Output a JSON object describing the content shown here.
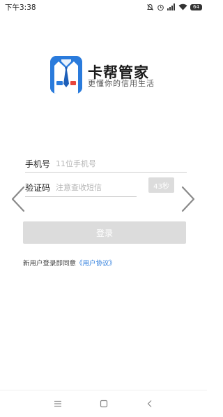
{
  "status_bar": {
    "time": "下午3:38",
    "battery": "64",
    "icons": [
      "mute-icon",
      "alarm-icon",
      "signal-icon",
      "wifi-icon",
      "battery-icon"
    ]
  },
  "app": {
    "name": "卡帮管家",
    "slogan": "更懂你的信用生活",
    "icon_color": "#2a7bdc"
  },
  "form": {
    "phone_label": "手机号",
    "phone_placeholder": "11位手机号",
    "phone_value": "",
    "code_label": "验证码",
    "code_placeholder": "注意查收短信",
    "code_value": "",
    "countdown": "43秒"
  },
  "login_button": "登录",
  "agreement": {
    "prefix": "新用户登录即同意",
    "link": "《用户协议》"
  },
  "nav": {
    "icons": [
      "menu-icon",
      "home-icon",
      "back-icon"
    ]
  },
  "colors": {
    "accent": "#2a7bdc",
    "disabled": "#dcdcdc"
  }
}
